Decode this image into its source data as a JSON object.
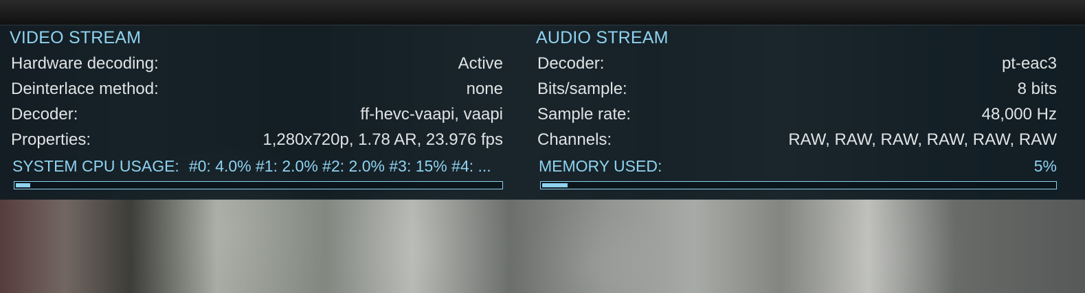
{
  "video": {
    "title": "VIDEO STREAM",
    "rows": [
      {
        "label": "Hardware decoding:",
        "value": "Active"
      },
      {
        "label": "Deinterlace method:",
        "value": "none"
      },
      {
        "label": "Decoder:",
        "value": "ff-hevc-vaapi, vaapi"
      },
      {
        "label": "Properties:",
        "value": "1,280x720p, 1.78 AR, 23.976 fps"
      }
    ],
    "cpu_label": "SYSTEM CPU USAGE:",
    "cpu_value": "#0: 4.0% #1: 2.0% #2: 2.0% #3:  15% #4: ...",
    "cpu_progress": 0.03
  },
  "audio": {
    "title": "AUDIO STREAM",
    "rows": [
      {
        "label": "Decoder:",
        "value": "pt-eac3"
      },
      {
        "label": "Bits/sample:",
        "value": "8 bits"
      },
      {
        "label": "Sample rate:",
        "value": "48,000 Hz"
      },
      {
        "label": "Channels:",
        "value": "RAW, RAW, RAW, RAW, RAW, RAW"
      }
    ],
    "memory_label": "MEMORY USED:",
    "memory_value": "5%",
    "memory_progress": 0.05
  },
  "colors": {
    "accent": "#8fd3f0",
    "text": "#dfe3e4",
    "overlay": "#0a1820"
  }
}
